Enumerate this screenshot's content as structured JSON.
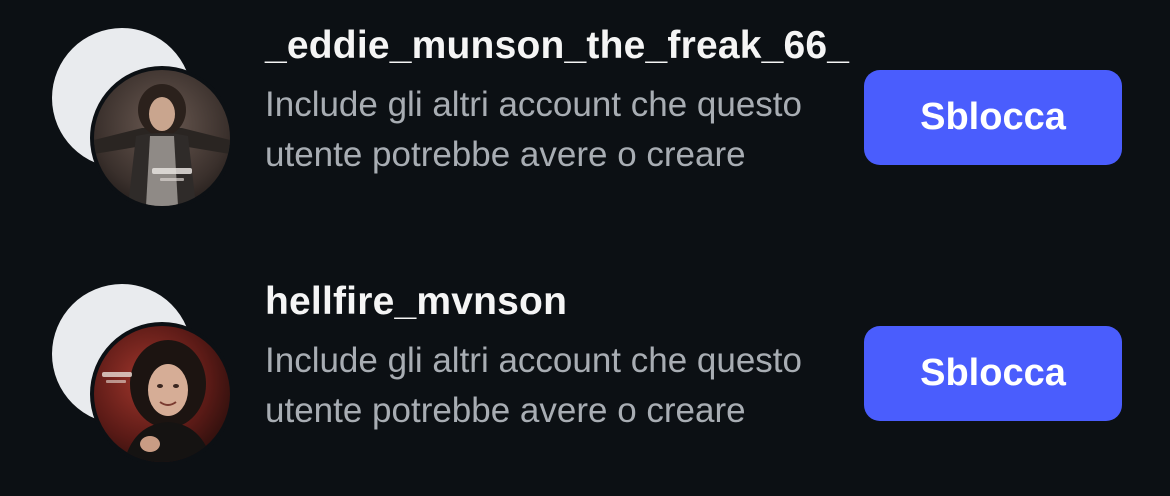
{
  "blocked_accounts": [
    {
      "username": "_eddie_munson_the_freak_66_",
      "description": "Include gli altri account che questo utente potrebbe avere o creare",
      "button_label": "Sblocca",
      "avatar_icon": "profile-photo"
    },
    {
      "username": "hellfire_mvnson",
      "description": "Include gli altri account che questo utente potrebbe avere o creare",
      "button_label": "Sblocca",
      "avatar_icon": "profile-photo"
    }
  ],
  "colors": {
    "background": "#0c1014",
    "button": "#4a5dfd",
    "username": "#f5f5f5",
    "description": "#a8adb3"
  }
}
